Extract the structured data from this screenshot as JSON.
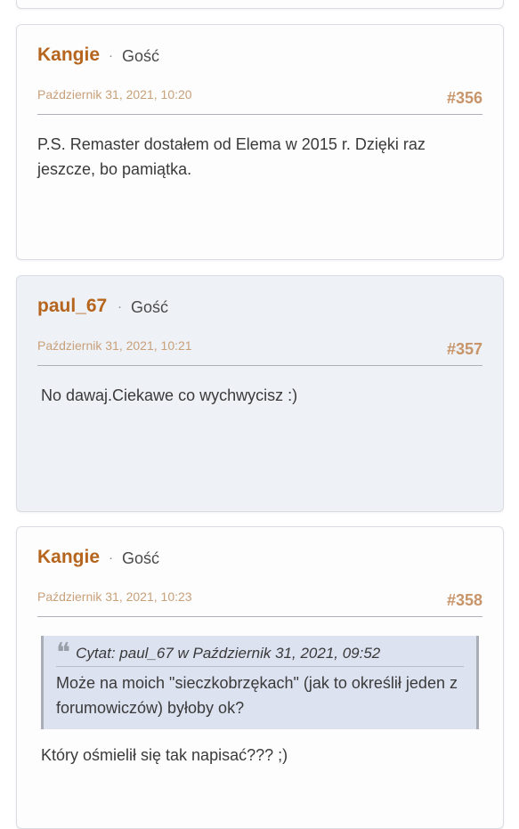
{
  "posts": [
    {
      "author": "Kangie",
      "separator": "·",
      "role": "Gość",
      "date": "Październik 31, 2021, 10:20",
      "number": "#356",
      "text": "P.S. Remaster dostałem od Elema w 2015 r. Dzięki raz jeszcze, bo pamiątka."
    },
    {
      "author": "paul_67",
      "separator": "·",
      "role": "Gość",
      "date": "Październik 31, 2021, 10:21",
      "number": "#357",
      "text": "No dawaj.Ciekawe co wychwycisz :)"
    },
    {
      "author": "Kangie",
      "separator": "·",
      "role": "Gość",
      "date": "Październik 31, 2021, 10:23",
      "number": "#358",
      "quote": {
        "icon": "quote-icon",
        "header": "Cytat: paul_67 w Październik 31, 2021, 09:52",
        "text": "Może na moich \"sieczkobrzękach\" (jak to określił jeden z forumowiczów) byłoby ok?"
      },
      "text": "Który ośmielił się tak napisać??? ;)"
    }
  ]
}
